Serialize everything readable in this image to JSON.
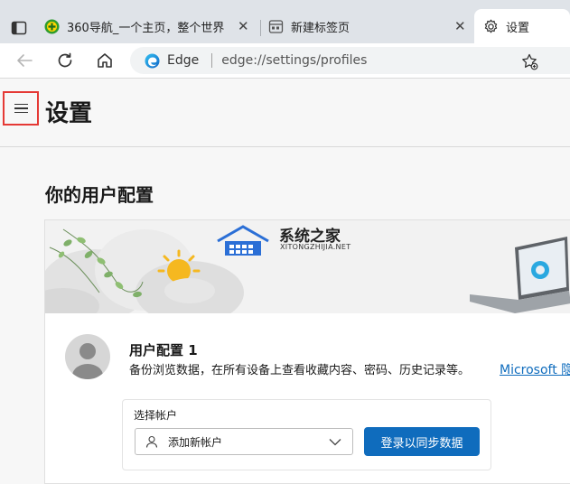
{
  "tabs": [
    {
      "title": "360导航_一个主页，整个世界",
      "close": "✕"
    },
    {
      "title": "新建标签页",
      "close": "✕"
    },
    {
      "title": "设置"
    }
  ],
  "address": {
    "brand": "Edge",
    "url": "edge://settings/profiles"
  },
  "page": {
    "title": "设置"
  },
  "profile_section": {
    "title": "你的用户配置",
    "watermark_name": "系统之家",
    "watermark_url": "XITONGZHIJIA.NET",
    "profile_name": "用户配置 1",
    "description": "备份浏览数据，在所有设备上查看收藏内容、密码、历史记录等。",
    "link_text": "Microsoft 隐"
  },
  "account": {
    "label": "选择帐户",
    "select_value": "添加新帐户",
    "sync_button": "登录以同步数据"
  },
  "colors": {
    "accent": "#0f6cbd",
    "highlight": "#e53935"
  }
}
